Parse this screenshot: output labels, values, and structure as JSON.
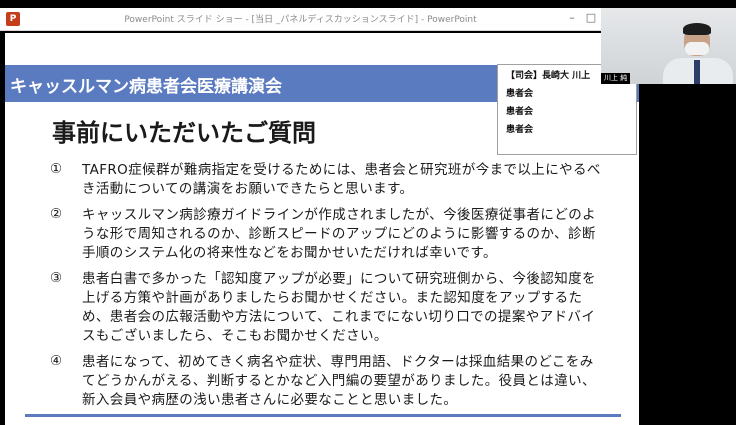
{
  "window": {
    "title": "PowerPoint スライド ショー - [当日 _パネルディスカッションスライド] - PowerPoint",
    "app_icon_letter": "P"
  },
  "slide": {
    "banner_title": "キャッスルマン病患者会医療講演会",
    "heading": "事前にいただいたご質問",
    "questions": [
      {
        "num": "①",
        "text": "TAFRO症候群が難病指定を受けるためには、患者会と研究班が今まで以上にやるべき活動についての講演をお願いできたらと思います。"
      },
      {
        "num": "②",
        "text": "キャッスルマン病診療ガイドラインが作成されましたが、今後医療従事者にどのような形で周知されるのか、診断スピードのアップにどのように影響するのか、診断手順のシステム化の将来性などをお聞かせいただければ幸いです。"
      },
      {
        "num": "③",
        "text": "患者白書で多かった「認知度アップが必要」について研究班側から、今後認知度を上げる方策や計画がありましたらお聞かせください。また認知度をアップするため、患者会の広報活動や方法について、これまでにない切り口での提案やアドバイスもございましたら、そこもお聞かせください。"
      },
      {
        "num": "④",
        "text": "患者になって、初めてきく病名や症状、専門用語、ドクターは採血結果のどこをみてどうかんがえる、判断するとかなど入門編の要望がありました。役員とは違い、新入会員や病歴の浅い患者さんに必要なことと思いました。"
      }
    ]
  },
  "panelists": [
    "【司会】長崎大 川上",
    "患者会",
    "患者会",
    "患者会"
  ],
  "webcam": {
    "name_label": "川上 純"
  },
  "colors": {
    "banner": "#5b7bc0",
    "ppt_icon": "#c43e1c"
  }
}
